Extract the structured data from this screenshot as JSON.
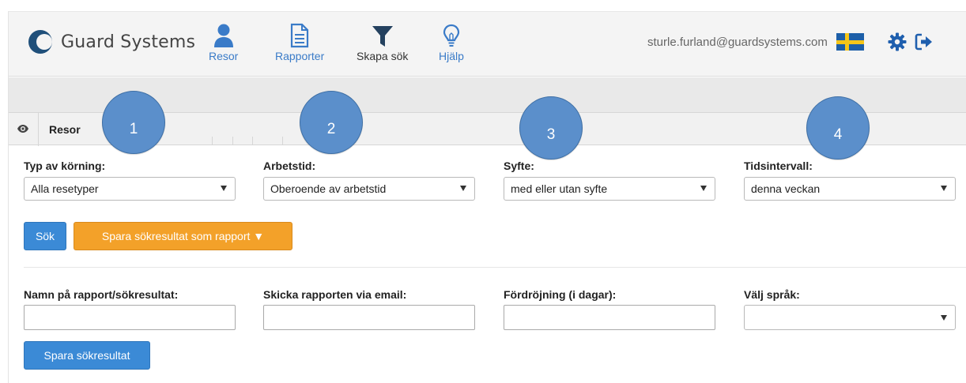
{
  "header": {
    "brand": "Guard Systems",
    "nav": [
      {
        "id": "resor",
        "label": "Resor",
        "icon": "user-icon"
      },
      {
        "id": "rapporter",
        "label": "Rapporter",
        "icon": "document-icon"
      },
      {
        "id": "skapa-sok",
        "label": "Skapa sök",
        "icon": "filter-icon"
      },
      {
        "id": "hjalp",
        "label": "Hjälp",
        "icon": "lightbulb-icon"
      }
    ],
    "user_email": "sturle.furland@guardsystems.com",
    "language_flag": "swedish-flag-icon",
    "settings_icon": "gear-icon",
    "logout_icon": "sign-out-icon"
  },
  "tab": {
    "label": "Resor",
    "icon": "eye-icon"
  },
  "callouts": [
    "1",
    "2",
    "3",
    "4"
  ],
  "filters": [
    {
      "label": "Typ av körning:",
      "value": "Alla resetyper"
    },
    {
      "label": "Arbetstid:",
      "value": "Oberoende av arbetstid"
    },
    {
      "label": "Syfte:",
      "value": "med eller utan syfte"
    },
    {
      "label": "Tidsintervall:",
      "value": "denna veckan"
    }
  ],
  "actions": {
    "search": "Sök",
    "save_as_report": "Spara sökresultat som rapport ▼"
  },
  "report_form": {
    "name_label": "Namn på rapport/sökresultat:",
    "name_value": "",
    "email_label": "Skicka rapporten via email:",
    "email_value": "",
    "delay_label": "Fördröjning (i dagar):",
    "delay_value": "",
    "language_label": "Välj språk:",
    "language_value": "",
    "save_button": "Spara sökresultat"
  },
  "colors": {
    "accent_blue": "#3b8ad6",
    "accent_orange": "#f3a129",
    "callout": "#5b8fcb",
    "nav_text": "#3a7bc8"
  }
}
